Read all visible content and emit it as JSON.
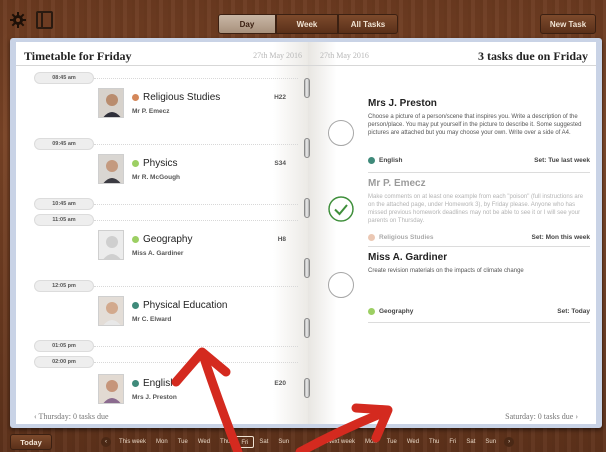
{
  "topbar": {
    "tabs": [
      {
        "label": "Day",
        "active": true
      },
      {
        "label": "Week",
        "active": false
      },
      {
        "label": "All Tasks",
        "active": false
      }
    ],
    "new_task_label": "New Task",
    "icons": [
      "gear-icon",
      "book-icon"
    ]
  },
  "left_page": {
    "title": "Timetable for Friday",
    "date": "27th May 2016",
    "times": [
      "08:45 am",
      "09:45 am",
      "10:45 am",
      "11:05 am",
      "12:05 pm",
      "01:05 pm",
      "02:00 pm"
    ],
    "lessons": [
      {
        "subject": "Religious Studies",
        "teacher": "Mr P. Emecz",
        "room": "H22",
        "color": "#d4875a"
      },
      {
        "subject": "Physics",
        "teacher": "Mr R. McGough",
        "room": "S34",
        "color": "#9ccf63"
      },
      {
        "subject": "Geography",
        "teacher": "Miss A. Gardiner",
        "room": "H8",
        "color": "#9ccf63"
      },
      {
        "subject": "Physical Education",
        "teacher": "Mr C. Elward",
        "room": "",
        "color": "#3f8a7a"
      },
      {
        "subject": "English",
        "teacher": "Mrs J. Preston",
        "room": "E20",
        "color": "#3f8a7a"
      }
    ],
    "footer": "‹ Thursday: 0 tasks due"
  },
  "right_page": {
    "date": "27th May 2016",
    "title": "3 tasks due on Friday",
    "tasks": [
      {
        "teacher": "Mrs J. Preston",
        "description": "Choose a picture of a person/scene that inspires you.  Write a description of the person/place.  You may put yourself in the picture to describe it.  Some suggested pictures are attached but you may choose your own.  Write over a side of A4.",
        "subject": "English",
        "subject_color": "#3f8a7a",
        "set": "Set: Tue last week",
        "done": false
      },
      {
        "teacher": "Mr P. Emecz",
        "description": "Make comments on at least one example from each \"poison\" (full instructions are on the attached page, under Homework 3), by Friday please.  Anyone who has missed previous homework deadlines may not be able to see it or I will see your parents on Thursday.",
        "subject": "Religious Studies",
        "subject_color": "#d4875a",
        "set": "Set: Mon this week",
        "done": true
      },
      {
        "teacher": "Miss A. Gardiner",
        "description": "Create revision materials on the impacts of climate change",
        "subject": "Geography",
        "subject_color": "#9ccf63",
        "set": "Set: Today",
        "done": false
      }
    ],
    "footer": "Saturday: 0 tasks due ›"
  },
  "bottombar": {
    "today_label": "Today",
    "week1_label": "This week",
    "week1_days": [
      "Mon",
      "Tue",
      "Wed",
      "Thu",
      "Fri",
      "Sat",
      "Sun"
    ],
    "week2_label": "Next week",
    "week2_days": [
      "Mon",
      "Tue",
      "Wed",
      "Thu",
      "Fri",
      "Sat",
      "Sun"
    ],
    "selected_day": "Fri"
  },
  "colors": {
    "wood": "#6b3a20",
    "arrow_red": "#d42a1f"
  }
}
